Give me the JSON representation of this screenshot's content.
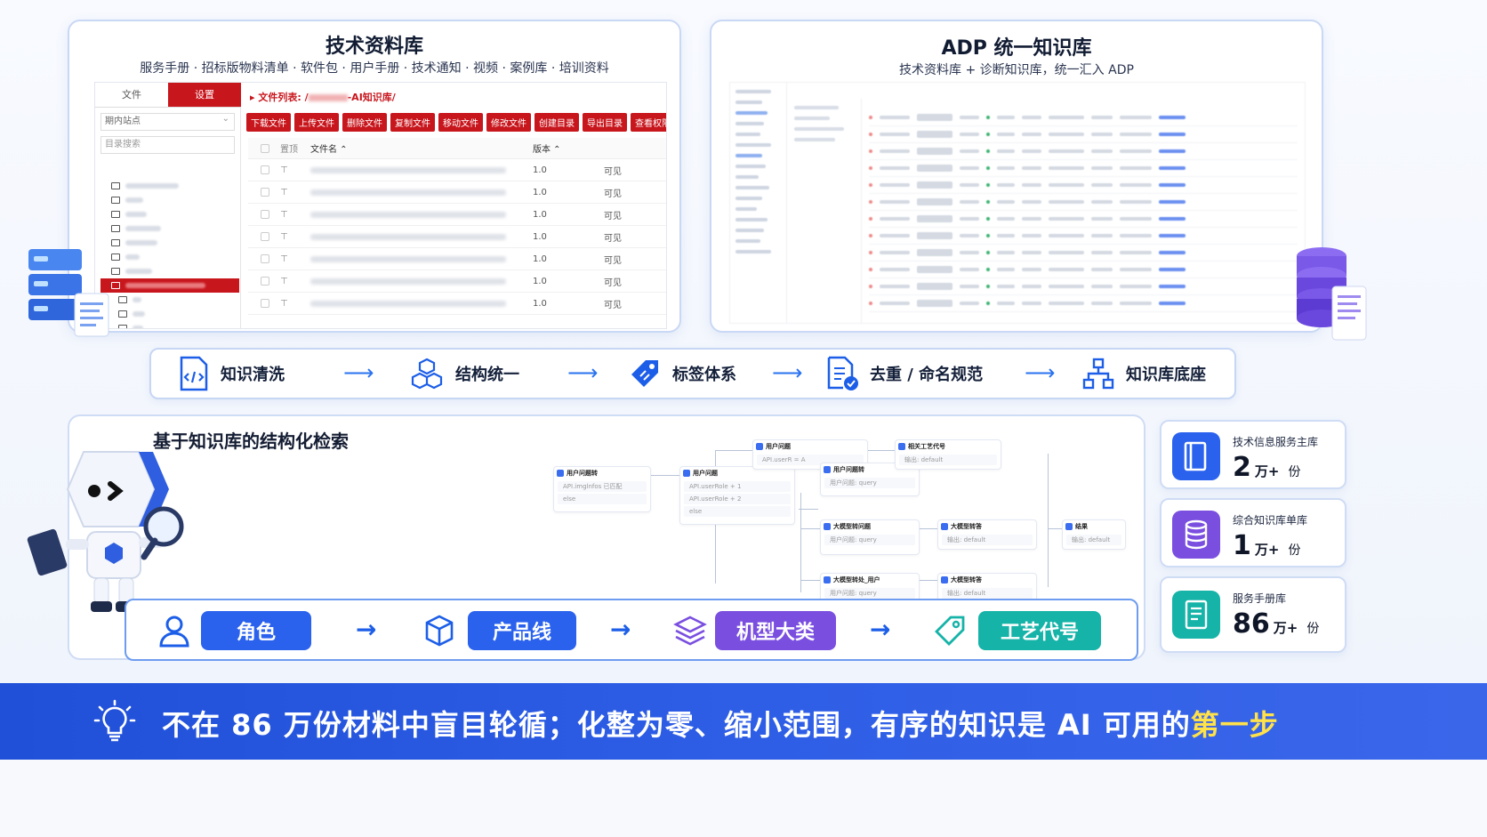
{
  "left_panel": {
    "title": "技术资料库",
    "subtitle": "服务手册 · 招标版物料清单 · 软件包 · 用户手册 · 技术通知 · 视频 · 案例库 · 培训资料",
    "tabs": [
      "文件",
      "设置"
    ],
    "site_select": "期内站点",
    "dir_search_placeholder": "目录搜索",
    "path_label": "▸ 文件列表: /",
    "path_suffix": "-AI知识库/",
    "buttons": [
      "下载文件",
      "上传文件",
      "删除文件",
      "复制文件",
      "移动文件",
      "修改文件",
      "创建目录",
      "导出目录",
      "查看权限"
    ],
    "columns": [
      "置顶",
      "文件名 ⌃",
      "版本 ⌃"
    ],
    "rows": [
      {
        "version": "1.0",
        "visibility": "可见"
      },
      {
        "version": "1.0",
        "visibility": "可见"
      },
      {
        "version": "1.0",
        "visibility": "可见"
      },
      {
        "version": "1.0",
        "visibility": "可见"
      },
      {
        "version": "1.0",
        "visibility": "可见"
      },
      {
        "version": "1.0",
        "visibility": "可见"
      },
      {
        "version": "1.0",
        "visibility": "可见"
      }
    ]
  },
  "right_panel": {
    "title": "ADP 统一知识库",
    "subtitle": "技术资料库 + 诊断知识库，统一汇入 ADP"
  },
  "pipeline": {
    "steps": [
      {
        "label": "知识清洗",
        "icon": "code-document-icon"
      },
      {
        "label": "结构统一",
        "icon": "cubes-icon"
      },
      {
        "label": "标签体系",
        "icon": "tag-icon"
      },
      {
        "label": "去重 / 命名规范",
        "icon": "document-check-icon"
      },
      {
        "label": "知识库底座",
        "icon": "hierarchy-icon"
      }
    ]
  },
  "retrieval": {
    "title": "基于知识库的结构化检索",
    "flow_nodes": {
      "n1": "用户问题转",
      "n2": "用户问题",
      "n3": "用户问题",
      "n4": "用户问题转",
      "n5": "相关工艺代号",
      "n6": "大模型转问题",
      "n7": "大模型转答",
      "n8": "大模型转处_用户",
      "n9": "大模型转答",
      "n10": "结果",
      "b1": "API.imglnfos 已匹配",
      "b2": "API.userRole + 1",
      "b3": "API.userRole + 2",
      "b4": "else",
      "b5": "用户问题: query",
      "b6": "输出: default",
      "b7": "API.userR = A"
    },
    "chain": [
      {
        "label": "角色",
        "icon": "user-icon",
        "color": "#2a62ee"
      },
      {
        "label": "产品线",
        "icon": "cube-icon",
        "color": "#2a62ee"
      },
      {
        "label": "机型大类",
        "icon": "layers-icon",
        "color": "#7a4fe0"
      },
      {
        "label": "工艺代号",
        "icon": "tag-outline-icon",
        "color": "#16b3a8"
      }
    ]
  },
  "stats": [
    {
      "label": "技术信息服务主库",
      "value": "2",
      "unit": "万+",
      "suffix": "份",
      "color": "#2a62ee",
      "icon": "book-icon"
    },
    {
      "label": "综合知识库单库",
      "value": "1",
      "unit": "万+",
      "suffix": "份",
      "color": "#7a4fe0",
      "icon": "database-icon"
    },
    {
      "label": "服务手册库",
      "value": "86",
      "unit": "万+",
      "suffix": "份",
      "color": "#16b3a8",
      "icon": "manual-icon"
    }
  ],
  "banner": {
    "text": "不在 86 万份材料中盲目轮循；化整为零、缩小范围，有序的知识是 AI 可用的",
    "highlight": "第一步",
    "icon": "lightbulb-icon"
  }
}
